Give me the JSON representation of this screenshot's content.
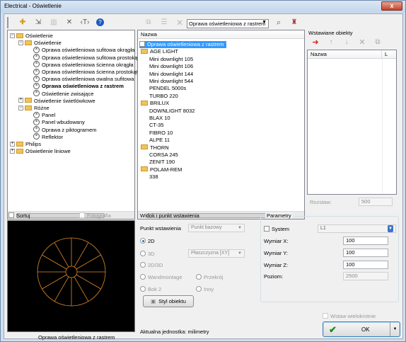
{
  "window": {
    "title": "Electrical - Oświetlenie",
    "close": "x"
  },
  "toolbar": {
    "search_value": "Oprawa oświetleniowa z rastrem",
    "search_placeholder": ""
  },
  "tree": {
    "items": [
      {
        "label": "Oświetlenie"
      },
      {
        "label": "Oświetlenie"
      },
      {
        "label": "Oprawa oświetleniowa sufitowa okrągła"
      },
      {
        "label": "Oprawa oświetleniowa sufitowa prostokątna"
      },
      {
        "label": "Oprawa oświetleniowa ścienna okrągła"
      },
      {
        "label": "Oprawa oświetleniowa ścienna prostokątna"
      },
      {
        "label": "Oprawa oświetleniowa owalna sufitowa"
      },
      {
        "label": "Oprawa oświetleniowa z rastrem"
      },
      {
        "label": "Oświetlenie zwisające"
      },
      {
        "label": "Oświetlenie świetlówkowe"
      },
      {
        "label": "Różne"
      },
      {
        "label": "Panel"
      },
      {
        "label": "Panel wbudowany"
      },
      {
        "label": "Oprawa z piktogramem"
      },
      {
        "label": "Reflektor"
      },
      {
        "label": "Philips"
      },
      {
        "label": "Oświetlenie liniowe"
      }
    ]
  },
  "list": {
    "header": "Nazwa",
    "items": [
      {
        "label": "Oprawa oświetleniowa z rastrem",
        "kind": "item"
      },
      {
        "label": "AGE LIGHT",
        "kind": "folder"
      },
      {
        "label": "Mini downlight 105",
        "kind": "child"
      },
      {
        "label": "Mini downlight 106",
        "kind": "child"
      },
      {
        "label": "Mini downlight 144",
        "kind": "child"
      },
      {
        "label": "Mini downlight 544",
        "kind": "child"
      },
      {
        "label": "PENDEL 5000s",
        "kind": "child"
      },
      {
        "label": "TURBO 220",
        "kind": "child"
      },
      {
        "label": "BRILUX",
        "kind": "folder"
      },
      {
        "label": "DOWNLIGHT 8032",
        "kind": "child"
      },
      {
        "label": "BLAX 10",
        "kind": "child"
      },
      {
        "label": "CT-35",
        "kind": "child"
      },
      {
        "label": "FIBRO 10",
        "kind": "child"
      },
      {
        "label": "ALPE 11",
        "kind": "child"
      },
      {
        "label": "THORN",
        "kind": "folder"
      },
      {
        "label": "CORSA 245",
        "kind": "child"
      },
      {
        "label": "ZENIT 190",
        "kind": "child"
      },
      {
        "label": "POLAM-REM",
        "kind": "folder"
      },
      {
        "label": "338",
        "kind": "child"
      }
    ]
  },
  "inserted": {
    "title": "Wstawiane obiekty",
    "col_name": "Nazwa",
    "col_l": "L",
    "spacing_label": "Rozstaw:",
    "spacing_value": "500"
  },
  "bottom_left": {
    "sort_label": "Sortuj",
    "photo_label": "Fotografia",
    "preview_caption": "Oprawa oświetleniowa z rastrem"
  },
  "view": {
    "title": "Widok i punkt wstawienia",
    "insert_point_label": "Punkt wstawienia",
    "insert_point_value": "Punkt bazowy",
    "radio_2d": "2D",
    "radio_3d": "3D",
    "plane_value": "Płaszczyzna [XY]",
    "radio_2d3d": "2D/3D",
    "radio_wandmontage": "Wandmontage",
    "radio_przekroj": "Przekrój",
    "radio_bok2": "Bok 2",
    "radio_inny": "Inny",
    "style_button": "Styl obiektu",
    "units_text": "Aktualna jednostka: milimetry"
  },
  "params": {
    "title": "Parametry",
    "system_label": "System",
    "system_value": "L1",
    "x_label": "Wymiar X:",
    "x_value": "100",
    "y_label": "Wymiar Y:",
    "y_value": "100",
    "z_label": "Wymiar Z:",
    "z_value": "100",
    "level_label": "Poziom:",
    "level_value": "2500",
    "multi_label": "Wstaw wielokrotnie",
    "ok_label": "OK"
  },
  "colors": {
    "accent": "#2b6ec9",
    "preview_line": "#e08a2c",
    "ok_check": "#1f8a1f"
  }
}
